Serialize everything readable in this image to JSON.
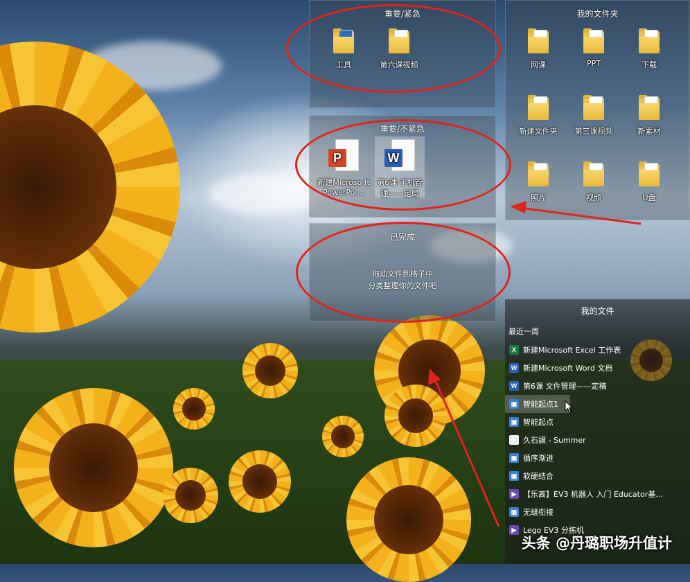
{
  "fences": {
    "important_urgent": {
      "title": "重要/紧急",
      "items": [
        {
          "label": "工具",
          "icon": "folder-icon"
        },
        {
          "label": "第六课视频",
          "icon": "folder-icon"
        }
      ]
    },
    "important_not_urgent": {
      "title": "重要/不紧急",
      "items": [
        {
          "label": "新建Microso ft PowerPoi...",
          "icon": "powerpoint-icon"
        },
        {
          "label": "第6课 手机管 理——定局",
          "icon": "word-icon"
        }
      ]
    },
    "done": {
      "title": "已完成",
      "hint_line1": "拖动文件到格子中",
      "hint_line2": "分类整理你的文件吧"
    },
    "my_folders": {
      "title": "我的文件夹",
      "items": [
        {
          "label": "网课"
        },
        {
          "label": "PPT"
        },
        {
          "label": "下载"
        },
        {
          "label": "新建文件夹"
        },
        {
          "label": "第三课视频"
        },
        {
          "label": "新素材"
        },
        {
          "label": "照片"
        },
        {
          "label": "视频"
        },
        {
          "label": "U盘"
        }
      ]
    }
  },
  "my_files": {
    "title": "我的文件",
    "group": "最近一周",
    "rows": [
      {
        "label": "新建Microsoft Excel 工作表",
        "icon": "excel-icon",
        "color": "#1f7a3e"
      },
      {
        "label": "新建Microsoft Word 文档",
        "icon": "word-icon",
        "color": "#2b5eb8"
      },
      {
        "label": "第6课 文件管理——定稿",
        "icon": "word-icon",
        "color": "#2b5eb8"
      },
      {
        "label": "智能起点1",
        "icon": "picture-icon",
        "color": "#3c7fd0"
      },
      {
        "label": "智能起点",
        "icon": "picture-icon",
        "color": "#3c7fd0"
      },
      {
        "label": "久石譲 - Summer",
        "icon": "blank-file-icon",
        "color": "#f2f2f2"
      },
      {
        "label": "循序渐进",
        "icon": "picture-icon",
        "color": "#3c7fd0"
      },
      {
        "label": "软硬结合",
        "icon": "picture-icon",
        "color": "#3c7fd0"
      },
      {
        "label": "【乐高】EV3 机器人 入门 Educator基...",
        "icon": "video-icon",
        "color": "#6a4bb0"
      },
      {
        "label": "无缝衔接",
        "icon": "picture-icon",
        "color": "#3c7fd0"
      },
      {
        "label": "Lego EV3 分拣机",
        "icon": "video-icon",
        "color": "#6a4bb0"
      }
    ]
  },
  "watermark": "头条 @丹璐职场升值计",
  "annotation_color": "#e3221c"
}
